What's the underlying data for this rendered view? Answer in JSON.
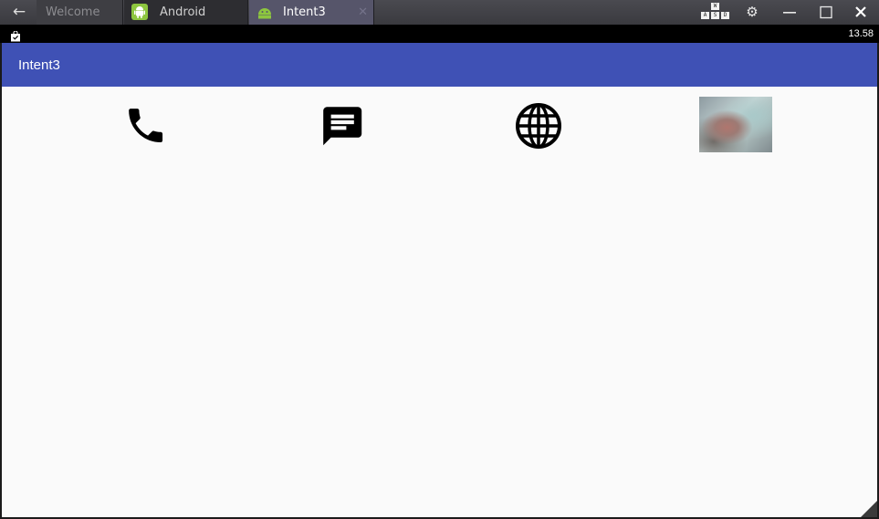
{
  "window": {
    "back_icon": "back-arrow-icon",
    "tabs": [
      {
        "label": "Welcome",
        "active": false
      },
      {
        "label": "Android",
        "active": false,
        "icon": "android-icon"
      },
      {
        "label": "Intent3",
        "active": true,
        "icon": "android-icon"
      }
    ],
    "tab_close_glyph": "✕",
    "keymap_keys": [
      "W",
      "A",
      "S",
      "D"
    ],
    "controls": [
      "keymap-icon",
      "gear-icon",
      "minimize-icon",
      "maximize-icon",
      "close-icon"
    ]
  },
  "status_bar": {
    "time": "13.58",
    "icon": "shopping-bag-icon"
  },
  "app_bar": {
    "title": "Intent3"
  },
  "actions": [
    {
      "name": "phone",
      "icon": "phone-icon"
    },
    {
      "name": "message",
      "icon": "message-icon"
    },
    {
      "name": "web",
      "icon": "globe-icon"
    },
    {
      "name": "photo",
      "icon": "photo-thumbnail"
    }
  ],
  "colors": {
    "app_bar": "#3f51b5",
    "background": "#fafafa",
    "android_green": "#8dc63f"
  }
}
